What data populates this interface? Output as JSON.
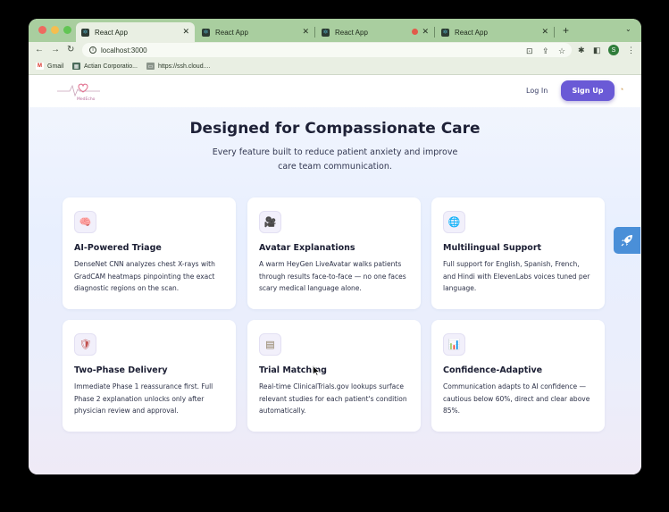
{
  "browser": {
    "tabs": [
      {
        "title": "React App",
        "active": true
      },
      {
        "title": "React App",
        "active": false
      },
      {
        "title": "React App",
        "active": false,
        "recording": true
      },
      {
        "title": "React App",
        "active": false
      }
    ],
    "new_tab_symbol": "+",
    "tab_menu_symbol": "⌄",
    "address": "localhost:3000",
    "bookmarks": [
      {
        "label": "Gmail",
        "icon": "gmail-icon"
      },
      {
        "label": "Actian Corporatio...",
        "icon": "actian-icon"
      },
      {
        "label": "https://ssh.cloud....",
        "icon": "ssh-icon"
      }
    ],
    "profile_initial": "S"
  },
  "app": {
    "logo_text": "MedEcho",
    "login_label": "Log In",
    "signup_label": "Sign Up"
  },
  "hero": {
    "title": "Designed for Compassionate Care",
    "subtitle": "Every feature built to reduce patient anxiety and improve care team communication."
  },
  "features": [
    {
      "icon": "🧠",
      "icon_name": "brain-icon",
      "title": "AI-Powered Triage",
      "desc": "DenseNet CNN analyzes chest X-rays with GradCAM heatmaps pinpointing the exact diagnostic regions on the scan."
    },
    {
      "icon": "🎥",
      "icon_name": "camera-icon",
      "title": "Avatar Explanations",
      "desc": "A warm HeyGen LiveAvatar walks patients through results face-to-face — no one faces scary medical language alone."
    },
    {
      "icon": "🌐",
      "icon_name": "globe-icon",
      "title": "Multilingual Support",
      "desc": "Full support for English, Spanish, French, and Hindi with ElevenLabs voices tuned per language."
    },
    {
      "icon": "🛡",
      "icon_name": "shield-icon",
      "title": "Two-Phase Delivery",
      "desc": "Immediate Phase 1 reassurance first. Full Phase 2 explanation unlocks only after physician review and approval."
    },
    {
      "icon": "▤",
      "icon_name": "document-icon",
      "title": "Trial Matching",
      "desc": "Real-time ClinicalTrials.gov lookups surface relevant studies for each patient's condition automatically."
    },
    {
      "icon": "📊",
      "icon_name": "bar-chart-icon",
      "title": "Confidence-Adaptive",
      "desc": "Communication adapts to AI confidence — cautious below 60%, direct and clear above 85%."
    }
  ],
  "colors": {
    "accent": "#6a5ad6",
    "tab_strip": "#a9ce9f",
    "floating_button": "#4a8fd8"
  }
}
